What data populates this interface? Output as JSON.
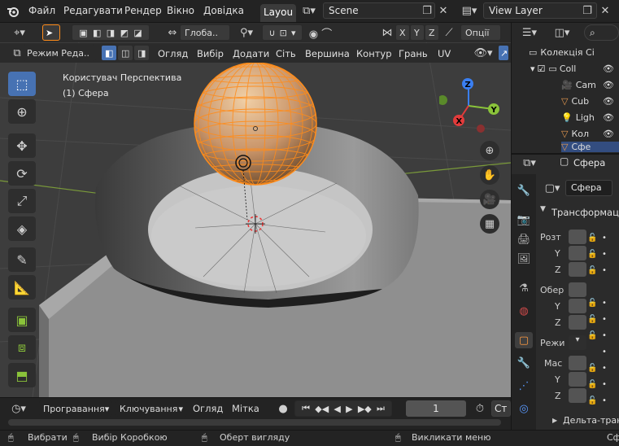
{
  "topbar": {
    "menus": [
      "Файл",
      "Редагувати",
      "Рендер",
      "Вікно",
      "Довідка"
    ],
    "active_tab": "Layou",
    "scene": "Scene",
    "view_layer": "View Layer"
  },
  "viewport_header": {
    "transform": "Глоба..",
    "options": "Опції",
    "axes": [
      "X",
      "Y",
      "Z"
    ],
    "mode": "Режим Реда..",
    "menus": [
      "Огляд",
      "Вибір",
      "Додати",
      "Сіть",
      "Вершина",
      "Контур",
      "Грань",
      "UV"
    ]
  },
  "viewport": {
    "view_name": "Користувач Перспектива",
    "object_name": "(1) Сфера",
    "gizmo": {
      "x": "X",
      "y": "Y",
      "z": "Z"
    }
  },
  "outliner": {
    "collection": "Колекція Сі",
    "items": [
      "Coll",
      "Cam",
      "Cub",
      "Ligh",
      "Кол",
      "Сфе"
    ]
  },
  "properties": {
    "object_name": "Сфера",
    "field_name": "Сфера",
    "section": "Трансформац",
    "location_label": "Розт",
    "rotation_label": "Обер",
    "mode_label": "Режи",
    "scale_label": "Мас",
    "y": "Y",
    "z": "Z",
    "delta": "Дельта-тран"
  },
  "timeline": {
    "playback": "Програвання",
    "keying": "Ключування",
    "view": "Огляд",
    "marker": "Мітка",
    "frame": "1",
    "start": "Ст"
  },
  "status": {
    "select": "Вибрати",
    "box_select": "Вибір Коробкою",
    "rotate_view": "Оберт вигляду",
    "context_menu": "Викликати меню",
    "edge": "Сф"
  },
  "colors": {
    "accent": "#4772b3",
    "selection": "#ff8c1a",
    "x_axis": "#e23b3b",
    "y_axis": "#8ac33a",
    "z_axis": "#3a7ff2"
  }
}
